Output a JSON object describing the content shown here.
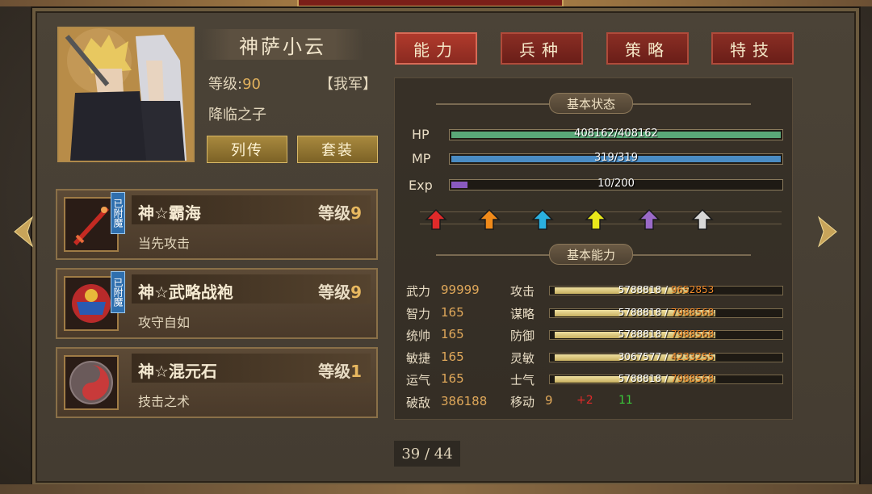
{
  "hero": {
    "name": "神萨小云",
    "level_label": "等级:",
    "level_value": "90",
    "camp": "【我军】",
    "title": "降临之子",
    "bio_button": "列传",
    "set_button": "套装"
  },
  "equipment": [
    {
      "name": "神☆霸海",
      "level_label": "等级",
      "level_value": "9",
      "desc": "当先攻击",
      "enchant": "已附魔",
      "icon": "sword-icon"
    },
    {
      "name": "神☆武略战袍",
      "level_label": "等级",
      "level_value": "9",
      "desc": "攻守自如",
      "enchant": "已附魔",
      "icon": "armor-icon"
    },
    {
      "name": "神☆混元石",
      "level_label": "等级",
      "level_value": "1",
      "desc": "技击之术",
      "icon": "orb-icon"
    }
  ],
  "tabs": [
    "能力",
    "兵种",
    "策略",
    "特技"
  ],
  "basic_status": {
    "label": "基本状态",
    "hp": {
      "label": "HP",
      "text": "408162/408162",
      "fill": 1.0,
      "color": "#5aa878"
    },
    "mp": {
      "label": "MP",
      "text": "319/319",
      "fill": 1.0,
      "color": "#4a8cc4"
    },
    "exp": {
      "label": "Exp",
      "text": "10/200",
      "fill": 0.05,
      "color": "#8a5ac0"
    }
  },
  "upgrade_arrows": [
    {
      "icon": "red-arrow-icon",
      "color": "#e02a2a"
    },
    {
      "icon": "orange-arrow-icon",
      "color": "#f08a1a"
    },
    {
      "icon": "cyan-arrow-icon",
      "color": "#2ab0e0"
    },
    {
      "icon": "yellow-arrow-icon",
      "color": "#e8e81a"
    },
    {
      "icon": "purple-arrow-icon",
      "color": "#9a6ac8"
    },
    {
      "icon": "white-arrow-icon",
      "color": "#d8d8d8"
    }
  ],
  "basic_ability": {
    "label": "基本能力",
    "attributes": [
      {
        "name": "武力",
        "value": "99999"
      },
      {
        "name": "智力",
        "value": "165"
      },
      {
        "name": "统帅",
        "value": "165"
      },
      {
        "name": "敏捷",
        "value": "165"
      },
      {
        "name": "运气",
        "value": "165"
      },
      {
        "name": "破敌",
        "value": "386188"
      }
    ],
    "combat": [
      {
        "name": "攻击",
        "cur": "5788818",
        "sep": "/",
        "max": "9652853",
        "fill": 0.6
      },
      {
        "name": "谋略",
        "cur": "5788818",
        "sep": "/",
        "max": "7988568",
        "fill": 0.72
      },
      {
        "name": "防御",
        "cur": "5788818",
        "sep": "/",
        "max": "7988568",
        "fill": 0.72
      },
      {
        "name": "灵敏",
        "cur": "3067577",
        "sep": "/",
        "max": "4233255",
        "fill": 0.72
      },
      {
        "name": "士气",
        "cur": "5788818",
        "sep": "/",
        "max": "7988568",
        "fill": 0.72
      }
    ],
    "move": {
      "name": "移动",
      "base": "9",
      "bonus": "+2",
      "total": "11"
    }
  },
  "page": "39 / 44"
}
